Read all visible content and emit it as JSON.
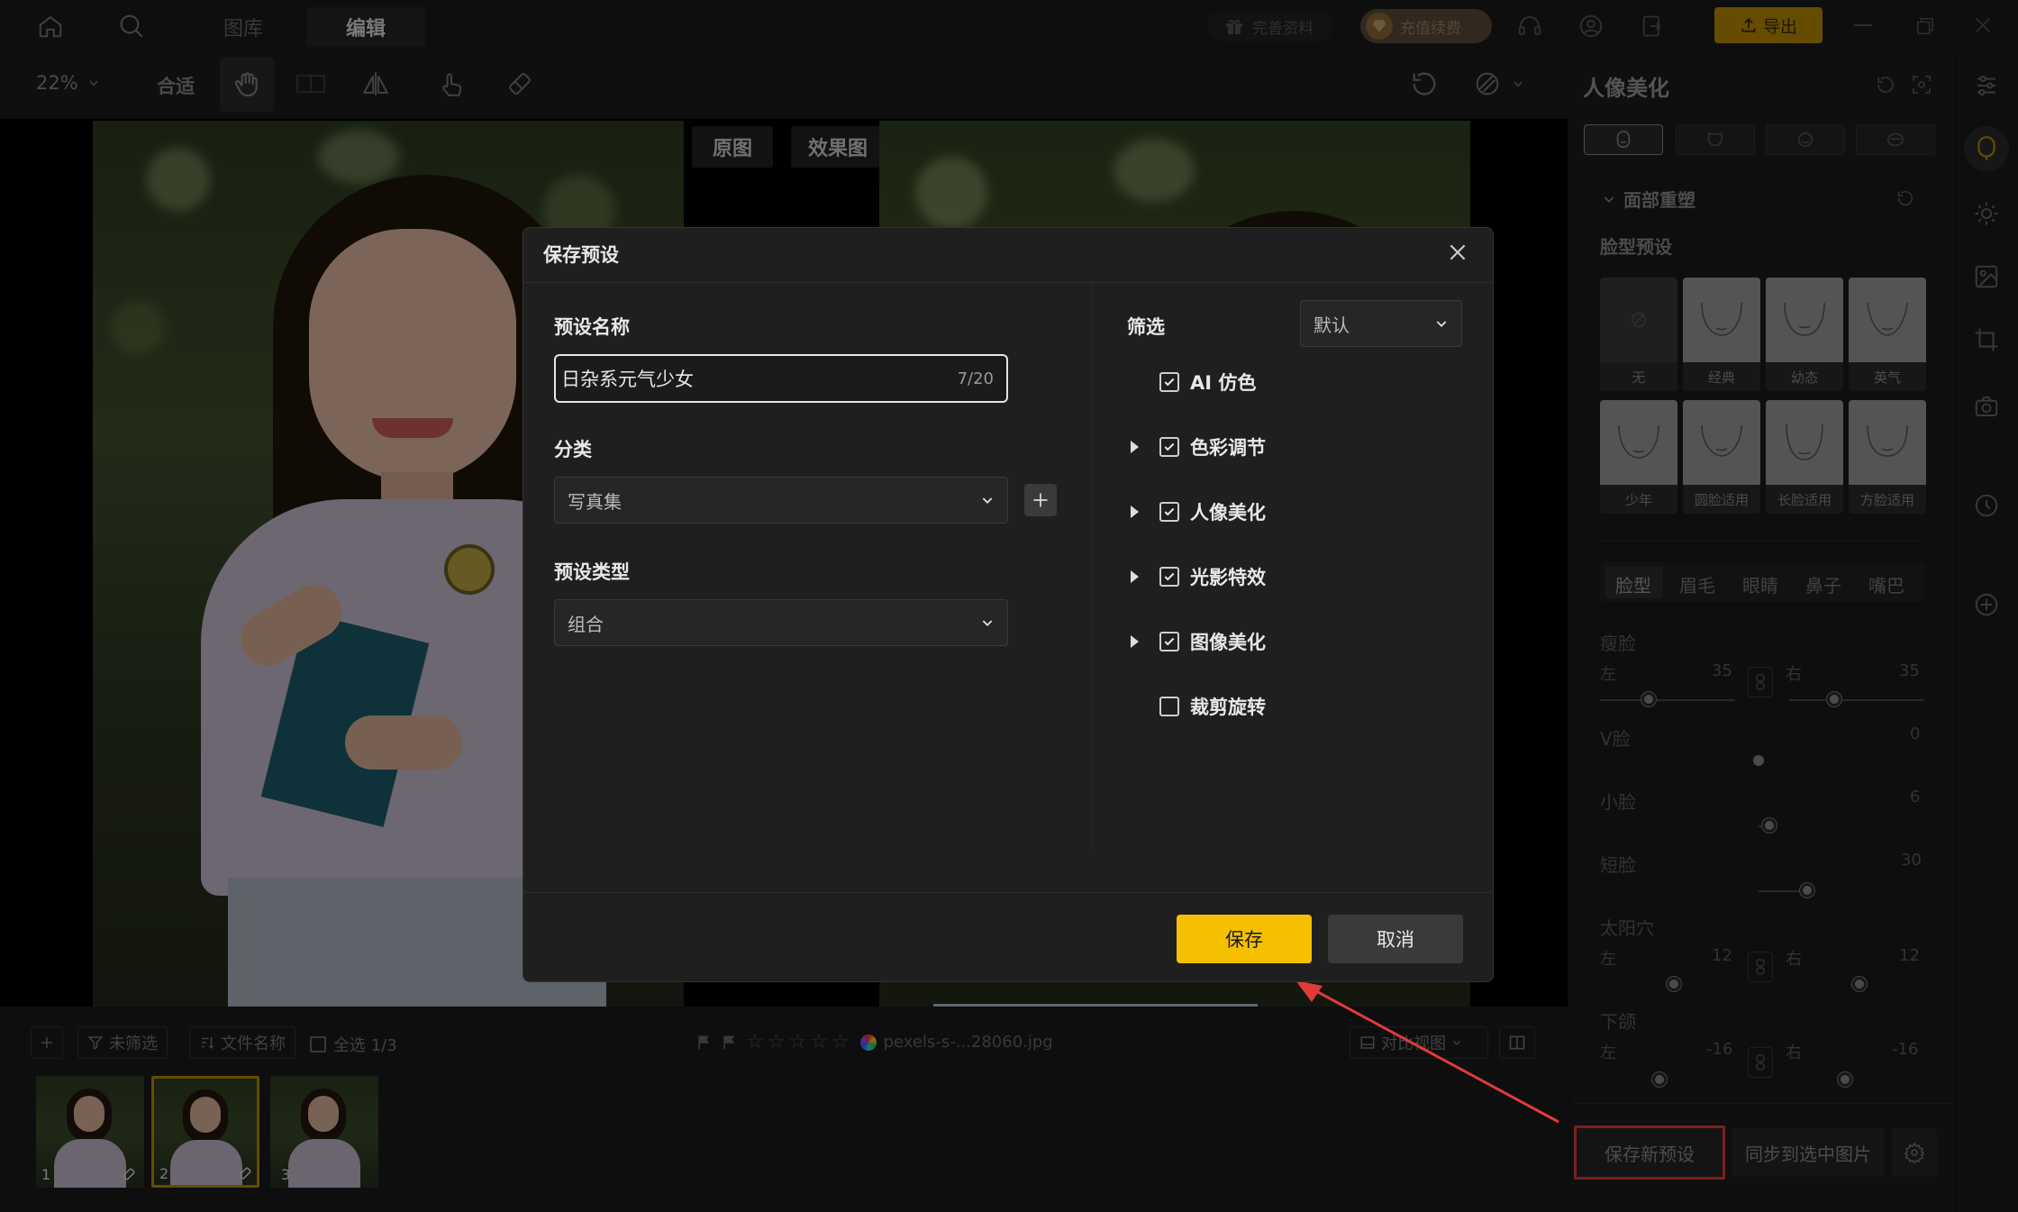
{
  "titlebar": {
    "tab_library": "图库",
    "tab_edit": "编辑",
    "complete_profile": "完善资料",
    "recharge": "充值续费",
    "export": "导出"
  },
  "toolbar": {
    "zoom": "22%",
    "fit": "合适"
  },
  "canvas": {
    "original_label": "原图",
    "effect_label": "效果图"
  },
  "right_panel": {
    "title": "人像美化",
    "section": "面部重塑",
    "face_preset_label": "脸型预设",
    "presets": [
      "无",
      "经典",
      "幼态",
      "英气",
      "少年",
      "圆脸适用",
      "长脸适用",
      "方脸适用"
    ],
    "feature_tabs": [
      "脸型",
      "眉毛",
      "眼睛",
      "鼻子",
      "嘴巴"
    ],
    "sliders": {
      "slim_face": {
        "label": "瘦脸",
        "left_label": "左",
        "left_value": "35",
        "left_level": 35,
        "right_label": "右",
        "right_value": "35",
        "right_level": 35
      },
      "v_face": {
        "label": "V脸",
        "value": "0",
        "level": 0
      },
      "small_face": {
        "label": "小脸",
        "value": "6",
        "level": 6
      },
      "short_face": {
        "label": "短脸",
        "value": "30",
        "level": 30
      },
      "temple": {
        "label": "太阳穴",
        "left_label": "左",
        "left_value": "12",
        "left_level": 12,
        "right_label": "右",
        "right_value": "12",
        "right_level": 12
      },
      "jaw": {
        "label": "下颌",
        "left_label": "左",
        "left_value": "-16",
        "left_level": -16,
        "right_label": "右",
        "right_value": "-16",
        "right_level": -16
      }
    },
    "save_new_preset": "保存新预设",
    "sync_selected": "同步到选中图片"
  },
  "bottom": {
    "unfiltered": "未筛选",
    "filename": "文件名称",
    "select_all": "全选 1/3",
    "file_name": "pexels-s-...28060.jpg",
    "compare_view": "对比视图",
    "thumbnails": [
      "1",
      "2",
      "3"
    ]
  },
  "modal": {
    "title": "保存预设",
    "name_label": "预设名称",
    "name_value": "日杂系元气少女",
    "name_count": "7/20",
    "category_label": "分类",
    "category_value": "写真集",
    "type_label": "预设类型",
    "type_value": "组合",
    "filter_label": "筛选",
    "filter_value": "默认",
    "options": [
      {
        "label": "AI 仿色",
        "checked": true,
        "expandable": false
      },
      {
        "label": "色彩调节",
        "checked": true,
        "expandable": true
      },
      {
        "label": "人像美化",
        "checked": true,
        "expandable": true
      },
      {
        "label": "光影特效",
        "checked": true,
        "expandable": true
      },
      {
        "label": "图像美化",
        "checked": true,
        "expandable": true
      },
      {
        "label": "裁剪旋转",
        "checked": false,
        "expandable": false
      }
    ],
    "save": "保存",
    "cancel": "取消"
  },
  "colors": {
    "accent_yellow": "#f5c000",
    "highlight_red": "#e03b3b",
    "background": "#141414"
  }
}
